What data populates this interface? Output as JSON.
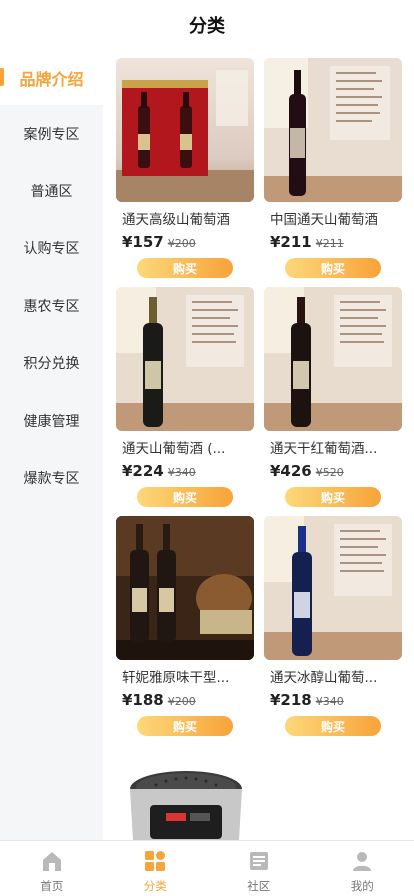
{
  "header": {
    "title": "分类"
  },
  "sidebar": {
    "items": [
      {
        "label": "品牌介绍",
        "active": true
      },
      {
        "label": "案例专区"
      },
      {
        "label": "普通区"
      },
      {
        "label": "认购专区"
      },
      {
        "label": "惠农专区"
      },
      {
        "label": "积分兑换"
      },
      {
        "label": "健康管理"
      },
      {
        "label": "爆款专区"
      }
    ]
  },
  "products": [
    {
      "title": "通天高级山葡萄酒",
      "price": "¥157",
      "old_price": "¥200",
      "buy_label": "购买",
      "image": "gift-box-two-bottles"
    },
    {
      "title": "中国通天山葡萄酒",
      "price": "¥211",
      "old_price": "¥211",
      "buy_label": "购买",
      "image": "single-bottle"
    },
    {
      "title": "通天山葡萄酒 (...",
      "price": "¥224",
      "old_price": "¥340",
      "buy_label": "购买",
      "image": "single-bottle"
    },
    {
      "title": "通天干红葡萄酒...",
      "price": "¥426",
      "old_price": "¥520",
      "buy_label": "购买",
      "image": "single-bottle"
    },
    {
      "title": "轩妮雅原味干型...",
      "price": "¥188",
      "old_price": "¥200",
      "buy_label": "购买",
      "image": "two-bottles-barrel"
    },
    {
      "title": "通天冰醇山葡萄...",
      "price": "¥218",
      "old_price": "¥340",
      "buy_label": "购买",
      "image": "blue-bottle"
    }
  ],
  "extra_item": {
    "image": "rice-cooker"
  },
  "tabbar": {
    "tabs": [
      {
        "label": "首页",
        "icon": "home-icon"
      },
      {
        "label": "分类",
        "icon": "category-icon",
        "active": true
      },
      {
        "label": "社区",
        "icon": "community-icon"
      },
      {
        "label": "我的",
        "icon": "profile-icon"
      }
    ]
  },
  "colors": {
    "accent": "#f7a43a",
    "button_gradient_start": "#fdd87a",
    "button_gradient_end": "#f8a33a",
    "sidebar_bg": "#f5f6f8"
  }
}
